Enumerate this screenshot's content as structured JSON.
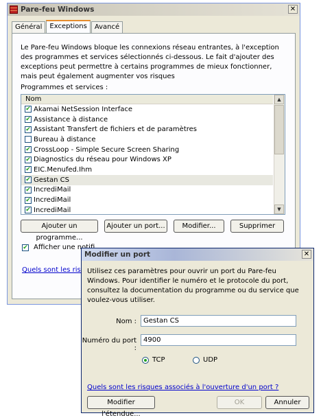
{
  "firewall": {
    "title": "Pare-feu Windows",
    "tabs": [
      {
        "label": "Général"
      },
      {
        "label": "Exceptions"
      },
      {
        "label": "Avancé"
      }
    ],
    "description": "Le Pare-feu Windows bloque les connexions réseau entrantes, à l'exception des programmes et services sélectionnés ci-dessous. Le fait d'ajouter des exceptions peut permettre à certains programmes de mieux fonctionner, mais peut également augmenter vos risques",
    "programs_label": "Programmes et services :",
    "column_header": "Nom",
    "programs": [
      {
        "name": "Akamai NetSession Interface",
        "checked": "✔"
      },
      {
        "name": "Assistance à distance",
        "checked": "✔"
      },
      {
        "name": "Assistant Transfert de fichiers et de paramètres",
        "checked": "✔"
      },
      {
        "name": "Bureau à distance",
        "checked": ""
      },
      {
        "name": "CrossLoop - Simple Secure Screen Sharing",
        "checked": "✔"
      },
      {
        "name": "Diagnostics du réseau pour Windows XP",
        "checked": "✔"
      },
      {
        "name": "EIC.Menufed.Ihm",
        "checked": "✔"
      },
      {
        "name": "Gestan CS",
        "checked": "✔"
      },
      {
        "name": "IncrediMail",
        "checked": "✔"
      },
      {
        "name": "IncrediMail",
        "checked": "✔"
      },
      {
        "name": "IncrediMail",
        "checked": "✔"
      }
    ],
    "buttons": {
      "add_program": "Ajouter un programme...",
      "add_port": "Ajouter un port...",
      "edit": "Modifier...",
      "delete": "Supprimer"
    },
    "notif_label": "Afficher une notifi",
    "risk_link": "Quels sont les risques"
  },
  "dialog": {
    "title": "Modifier un port",
    "description": "Utilisez ces paramètres pour ouvrir un port du Pare-feu Windows. Pour identifier le numéro et le protocole du port, consultez la documentation du programme ou du service que voulez-vous utiliser.",
    "name_label": "Nom :",
    "name_value": "Gestan CS",
    "port_label": "Numéro du port :",
    "port_value": "4900",
    "tcp_label": "TCP",
    "udp_label": "UDP",
    "risk_link": "Quels sont les risques associés à l'ouverture d'un port ?",
    "scope_button": "Modifier l'étendue...",
    "ok_button": "OK",
    "cancel_button": "Annuler"
  },
  "colors": {
    "checkmark": "#21a121",
    "link": "#0000cc"
  }
}
